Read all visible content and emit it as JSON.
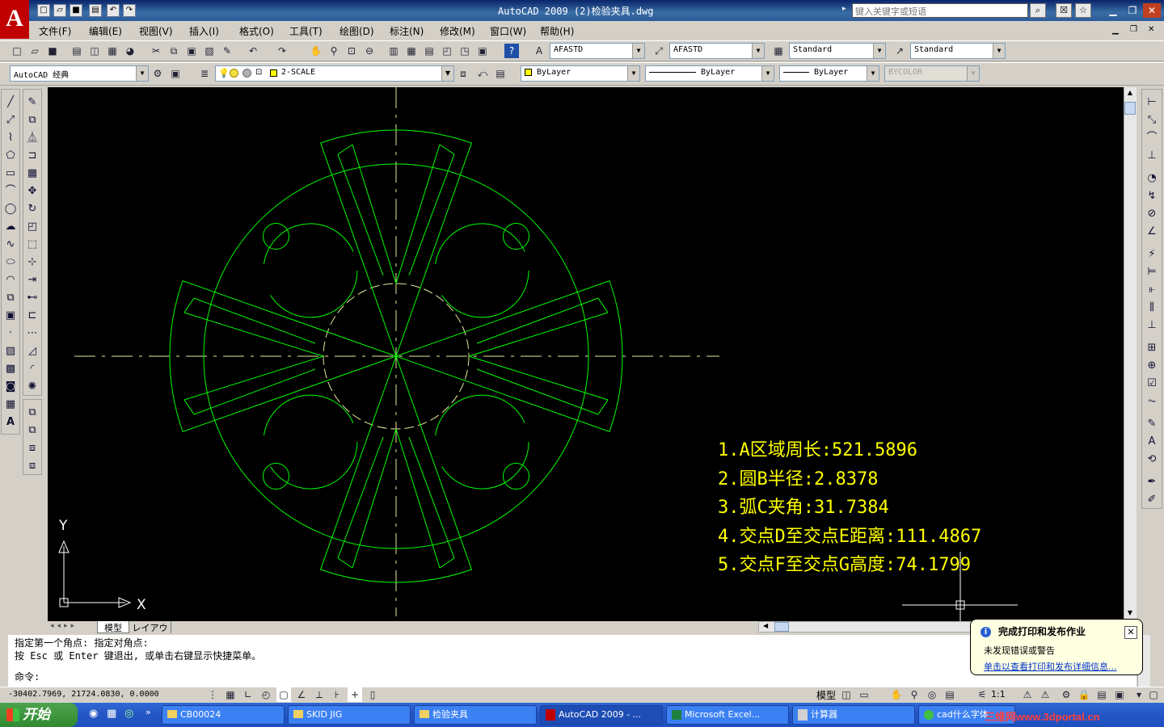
{
  "app": {
    "title": "AutoCAD 2009  (2)检验夹具.dwg",
    "logo_letter": "A",
    "search_placeholder": "键入关键字或短语",
    "accent": "#0a246a"
  },
  "menu": [
    "文件(F)",
    "编辑(E)",
    "视图(V)",
    "插入(I)",
    "格式(O)",
    "工具(T)",
    "绘图(D)",
    "标注(N)",
    "修改(M)",
    "窗口(W)",
    "帮助(H)"
  ],
  "toolbar": {
    "text_style": "AFASTD",
    "dim_style": "AFASTD",
    "table_style": "Standard",
    "multileader_style": "Standard",
    "workspace": "AutoCAD 经典",
    "layer": "2-SCALE",
    "color": "ByLayer",
    "linetype": "ByLayer",
    "lineweight": "ByLayer",
    "plotstyle": "BYCOLOR"
  },
  "drawing": {
    "line_color": "#00ff00",
    "center_color": "#e8e8a0",
    "notes": [
      "1.A区域周长:521.5896",
      "2.圆B半径:2.8378",
      "3.弧C夹角:31.7384",
      "4.交点D至交点E距离:111.4867",
      "5.交点F至交点G高度:74.1799"
    ],
    "ucs_x": "X",
    "ucs_y": "Y"
  },
  "tabs": [
    "模型",
    "レイアウト1"
  ],
  "command": {
    "line1": "指定第一个角点: 指定对角点:",
    "line2": "按 Esc 或 Enter 键退出, 或单击右键显示快捷菜单。",
    "prompt": "命令:"
  },
  "status": {
    "coords": "-30402.7969, 21724.0830, 0.0000",
    "model": "模型",
    "scale": "1:1"
  },
  "balloon": {
    "title": "完成打印和发布作业",
    "line1": "未发现错误或警告",
    "link": "单击以查看打印和发布详细信息..."
  },
  "taskbar": {
    "start": "开始",
    "tasks": [
      "CB00024",
      "SKID JIG",
      "检验夹具",
      "AutoCAD 2009 - ...",
      "Microsoft Excel...",
      "计算器",
      "cad什么字体"
    ],
    "watermark": "三维网www.3dportal.cn"
  }
}
